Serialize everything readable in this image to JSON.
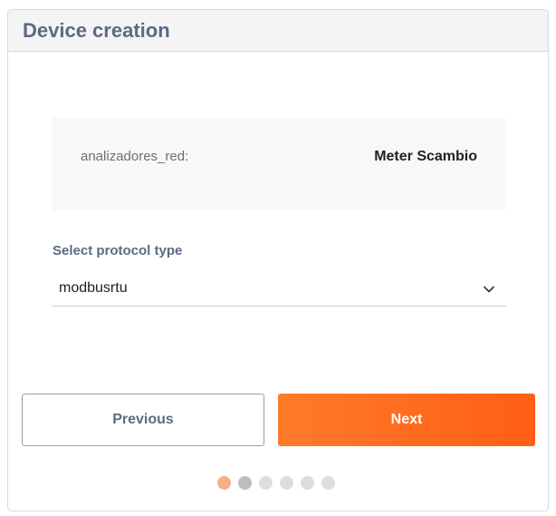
{
  "header": {
    "title": "Device creation"
  },
  "info": {
    "key": "analizadores_red:",
    "value": "Meter Scambio"
  },
  "protocol": {
    "label": "Select protocol type",
    "selected": "modbusrtu"
  },
  "buttons": {
    "previous": "Previous",
    "next": "Next"
  },
  "stepper": {
    "total_steps": 6,
    "current_step": 1,
    "visited_step": 2
  },
  "colors": {
    "accent": "#ff6a1f",
    "title_text": "#5b6b82",
    "dot_active": "#f5b08a",
    "dot_visited": "#bdbdbd",
    "dot_inactive": "#dddddd"
  },
  "icons": {
    "select_arrow": "chevron-down-icon"
  }
}
